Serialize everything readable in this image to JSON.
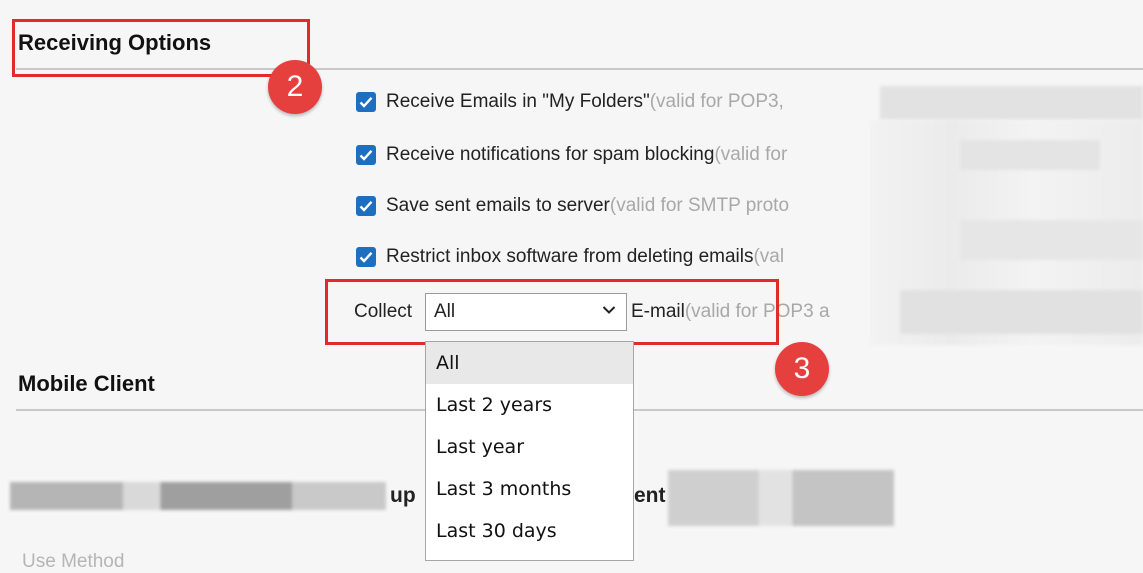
{
  "receiving": {
    "title": "Receiving Options",
    "badge": "2",
    "options": [
      {
        "label": "Receive Emails in \"My Folders\"",
        "note": "(valid for POP3,",
        "checked": true
      },
      {
        "label": "Receive notifications for spam blocking",
        "note": "(valid for",
        "checked": true
      },
      {
        "label": "Save sent emails to server",
        "note": "(valid for SMTP proto",
        "checked": true
      },
      {
        "label": "Restrict inbox software from deleting emails",
        "note": "(val",
        "checked": true
      }
    ],
    "collect": {
      "prefix": "Collect",
      "selected": "All",
      "suffix": "E-mail",
      "note": "(valid for POP3 a",
      "badge": "3"
    }
  },
  "dropdown": {
    "options": [
      "All",
      "Last 2 years",
      "Last year",
      "Last 3 months",
      "Last 30 days"
    ],
    "highlighted": "All"
  },
  "mobile": {
    "title": "Mobile Client",
    "partial_heading_left": "up",
    "partial_heading_right": "ent",
    "partial_bottom": "Use Method"
  },
  "colors": {
    "accent": "#1f6fc1",
    "highlight_box": "#e22a2a",
    "badge": "#e5403d",
    "note_text": "#a8a8a8"
  }
}
